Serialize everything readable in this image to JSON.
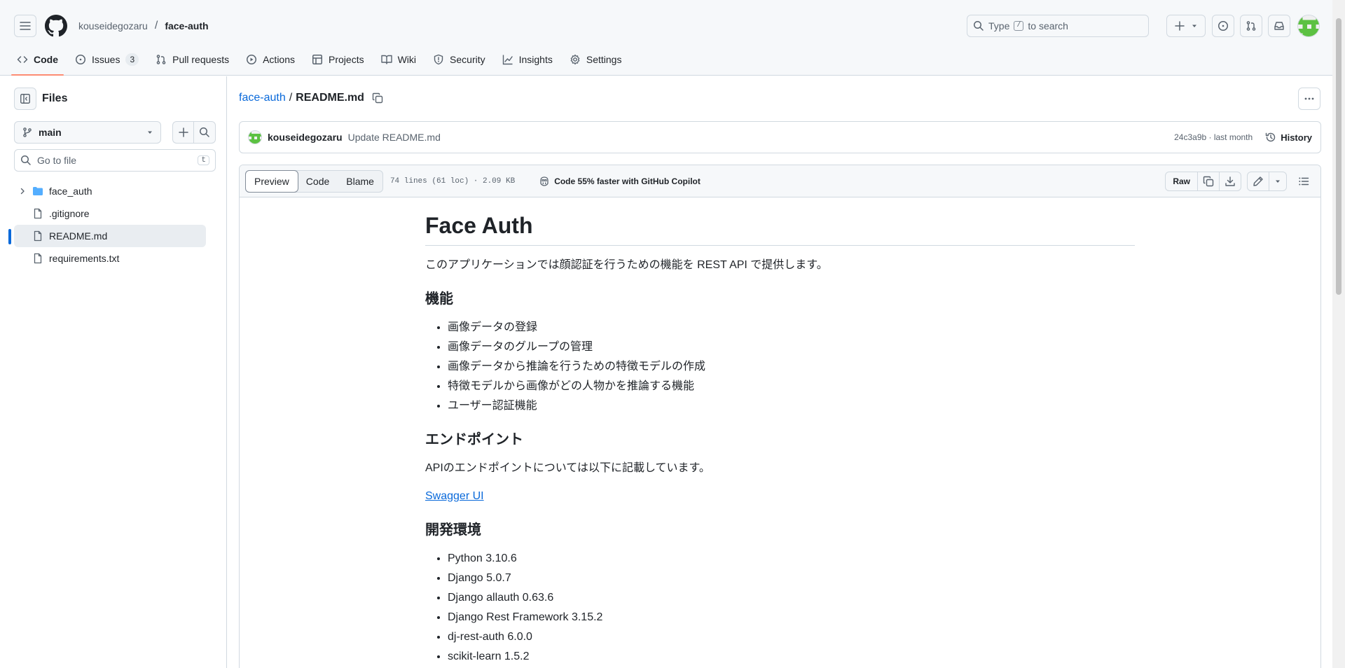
{
  "header": {
    "owner": "kouseidegozaru",
    "repo": "face-auth",
    "search_placeholder_pre": "Type",
    "search_key": "/",
    "search_placeholder_post": "to search"
  },
  "repo_nav": [
    {
      "label": "Code",
      "icon": "code-icon",
      "active": true
    },
    {
      "label": "Issues",
      "icon": "issue-icon",
      "count": "3"
    },
    {
      "label": "Pull requests",
      "icon": "pull-request-icon"
    },
    {
      "label": "Actions",
      "icon": "play-icon"
    },
    {
      "label": "Projects",
      "icon": "table-icon"
    },
    {
      "label": "Wiki",
      "icon": "book-icon"
    },
    {
      "label": "Security",
      "icon": "shield-icon"
    },
    {
      "label": "Insights",
      "icon": "graph-icon"
    },
    {
      "label": "Settings",
      "icon": "gear-icon"
    }
  ],
  "sidebar": {
    "title": "Files",
    "branch": "main",
    "goto_placeholder": "Go to file",
    "goto_key": "t",
    "tree": [
      {
        "name": "face_auth",
        "type": "folder"
      },
      {
        "name": ".gitignore",
        "type": "file"
      },
      {
        "name": "README.md",
        "type": "file",
        "selected": true
      },
      {
        "name": "requirements.txt",
        "type": "file"
      }
    ]
  },
  "main": {
    "path_repo": "face-auth",
    "path_sep": "/",
    "path_file": "README.md",
    "commit": {
      "author": "kouseidegozaru",
      "message": "Update README.md",
      "meta": "24c3a9b · last month",
      "history_label": "History"
    },
    "filebar": {
      "tabs": [
        "Preview",
        "Code",
        "Blame"
      ],
      "stats": "74 lines (61 loc) · 2.09 KB",
      "copilot": "Code 55% faster with GitHub Copilot",
      "raw_label": "Raw"
    }
  },
  "readme": {
    "title": "Face Auth",
    "intro": "このアプリケーションでは顔認証を行うための機能を REST API で提供します。",
    "features_heading": "機能",
    "features": [
      "画像データの登録",
      "画像データのグループの管理",
      "画像データから推論を行うための特徴モデルの作成",
      "特徴モデルから画像がどの人物かを推論する機能",
      "ユーザー認証機能"
    ],
    "endpoint_heading": "エンドポイント",
    "endpoint_text": "APIのエンドポイントについては以下に記載しています。",
    "swagger_link": "Swagger UI",
    "env_heading": "開発環境",
    "env": [
      "Python 3.10.6",
      "Django 5.0.7",
      "Django allauth 0.63.6",
      "Django Rest Framework 3.15.2",
      "dj-rest-auth 6.0.0",
      "scikit-learn 1.5.2"
    ]
  },
  "colors": {
    "accent": "#0969da",
    "tab_underline": "#fd8c73",
    "border": "#d1d9e0",
    "header_bg": "#f6f8fa"
  }
}
